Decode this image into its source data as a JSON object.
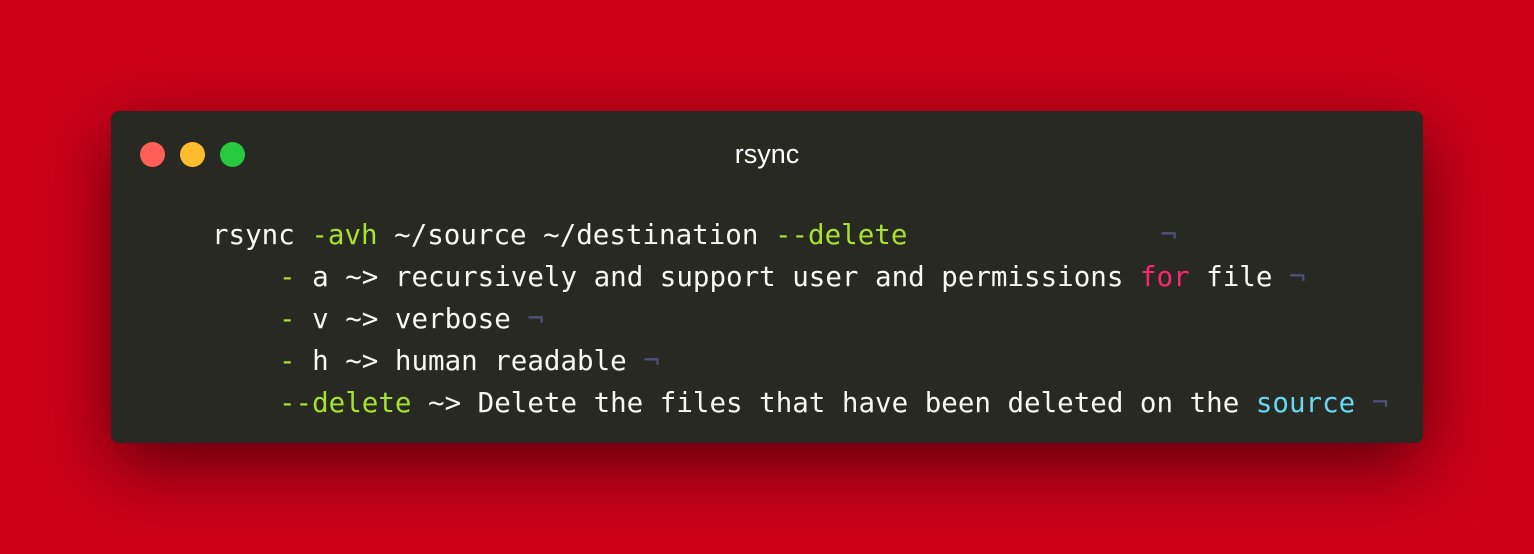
{
  "window": {
    "title": "rsync",
    "controls": [
      {
        "name": "close",
        "color": "#ff5f56"
      },
      {
        "name": "minimize",
        "color": "#ffbd2e"
      },
      {
        "name": "zoom",
        "color": "#27c93f"
      }
    ]
  },
  "theme": {
    "background": "#cc0019",
    "editor_bg": "#282923",
    "text": "#f8f8f2",
    "flag": "#a6e22e",
    "keyword": "#f92672",
    "builtin": "#66d9ef",
    "invisible": "#4f5078"
  },
  "code": {
    "lines": [
      [
        {
          "t": "rsync ",
          "c": "text"
        },
        {
          "t": "-avh",
          "c": "flag"
        },
        {
          "t": " ~/source ~/destination ",
          "c": "text"
        },
        {
          "t": "--delete",
          "c": "flag"
        },
        {
          "pad": true
        },
        {
          "t": "¬",
          "c": "invisible"
        }
      ],
      [
        {
          "indent": true
        },
        {
          "t": "-",
          "c": "flag"
        },
        {
          "t": " a ~> recursively and support user and permissions ",
          "c": "text"
        },
        {
          "t": "for",
          "c": "keyword"
        },
        {
          "t": " file ",
          "c": "text"
        },
        {
          "t": "¬",
          "c": "invisible"
        }
      ],
      [
        {
          "indent": true
        },
        {
          "t": "-",
          "c": "flag"
        },
        {
          "t": " v ~> verbose ",
          "c": "text"
        },
        {
          "t": "¬",
          "c": "invisible"
        }
      ],
      [
        {
          "indent": true
        },
        {
          "t": "-",
          "c": "flag"
        },
        {
          "t": " h ~> human readable ",
          "c": "text"
        },
        {
          "t": "¬",
          "c": "invisible"
        }
      ],
      [
        {
          "indent": true
        },
        {
          "t": "--delete",
          "c": "flag"
        },
        {
          "t": " ~> Delete the files that have been deleted on the ",
          "c": "text"
        },
        {
          "t": "source",
          "c": "builtin"
        },
        {
          "t": " ",
          "c": "text"
        },
        {
          "t": "¬",
          "c": "invisible"
        }
      ]
    ]
  }
}
